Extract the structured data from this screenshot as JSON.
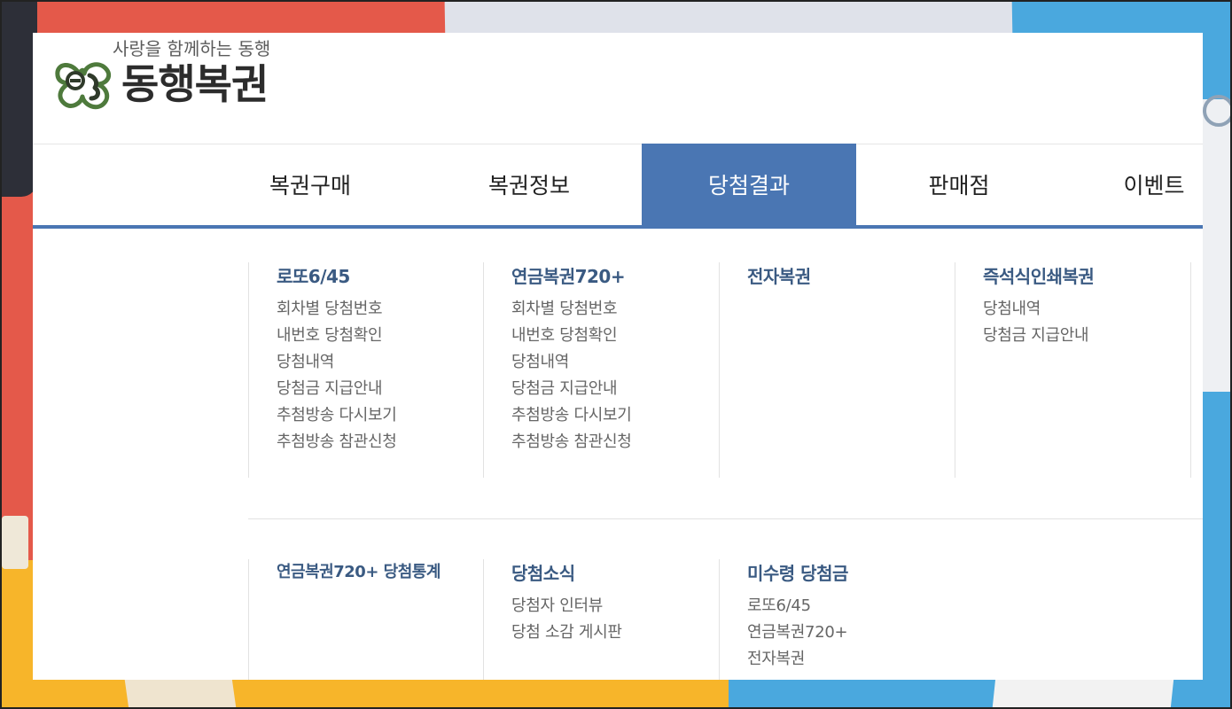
{
  "logo": {
    "tagline": "사랑을 함께하는 동행",
    "name": "동행복권",
    "brand_color": "#4e7a3c"
  },
  "nav": {
    "accent_color": "#4a76b3",
    "items": [
      {
        "label": "복권구매",
        "active": false
      },
      {
        "label": "복권정보",
        "active": false
      },
      {
        "label": "당첨결과",
        "active": true
      },
      {
        "label": "판매점",
        "active": false
      },
      {
        "label": "이벤트",
        "active": false
      }
    ]
  },
  "menu": {
    "row1": [
      {
        "title": "로또6/45",
        "links": [
          "회차별 당첨번호",
          "내번호 당첨확인",
          "당첨내역",
          "당첨금 지급안내",
          "추첨방송 다시보기",
          "추첨방송 참관신청"
        ]
      },
      {
        "title": "연금복권720+",
        "links": [
          "회차별 당첨번호",
          "내번호 당첨확인",
          "당첨내역",
          "당첨금 지급안내",
          "추첨방송 다시보기",
          "추첨방송 참관신청"
        ]
      },
      {
        "title": "전자복권",
        "links": []
      },
      {
        "title": "즉석식인쇄복권",
        "links": [
          "당첨내역",
          "당첨금 지급안내"
        ]
      }
    ],
    "row2": [
      {
        "title": "연금복권720+ 당첨통계",
        "links": []
      },
      {
        "title": "당첨소식",
        "links": [
          "당첨자 인터뷰",
          "당첨 소감 게시판"
        ]
      },
      {
        "title": "미수령 당첨금",
        "links": [
          "로또6/45",
          "연금복권720+",
          "전자복권"
        ]
      }
    ]
  }
}
